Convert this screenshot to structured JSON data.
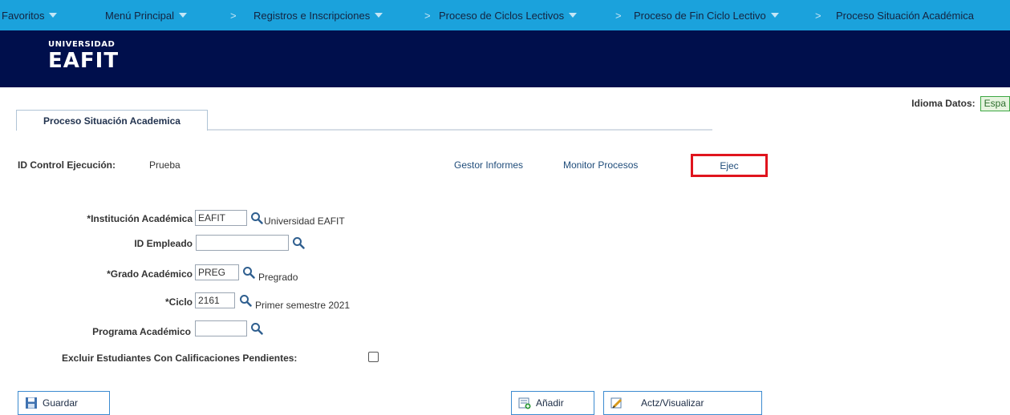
{
  "nav": {
    "favoritos": "Favoritos",
    "menu_principal": "Menú Principal",
    "registros": "Registros e Inscripciones",
    "proceso_ciclos": "Proceso de Ciclos Lectivos",
    "proceso_fin": "Proceso de Fin Ciclo Lectivo",
    "proceso_situacion": "Proceso Situación Académica",
    "separator": ">"
  },
  "logo": {
    "top": "UNIVERSIDAD",
    "main": "EAFIT"
  },
  "idioma": {
    "label": "Idioma Datos:",
    "value": "Espa"
  },
  "tab": {
    "label": "Proceso Situación Academica"
  },
  "run_control": {
    "label": "ID Control Ejecución:",
    "value": "Prueba",
    "gestor_informes": "Gestor Informes",
    "monitor_procesos": "Monitor Procesos",
    "ejec": "Ejec"
  },
  "form": {
    "institucion": {
      "label": "*Institución Académica",
      "value": "EAFIT",
      "description": "Universidad EAFIT"
    },
    "empleado": {
      "label": "ID Empleado",
      "value": ""
    },
    "grado": {
      "label": "*Grado Académico",
      "value": "PREG",
      "description": "Pregrado"
    },
    "ciclo": {
      "label": "*Ciclo",
      "value": "2161",
      "description": "Primer semestre 2021"
    },
    "programa": {
      "label": "Programa Académico",
      "value": ""
    },
    "excluir": {
      "label": "Excluir Estudiantes Con Calificaciones Pendientes:",
      "checked": false
    }
  },
  "buttons": {
    "guardar": "Guardar",
    "anadir": "Añadir",
    "actz": "Actz/Visualizar"
  },
  "icons": {
    "search": "search-icon",
    "save": "save-icon",
    "add": "add-icon",
    "edit": "edit-icon"
  }
}
